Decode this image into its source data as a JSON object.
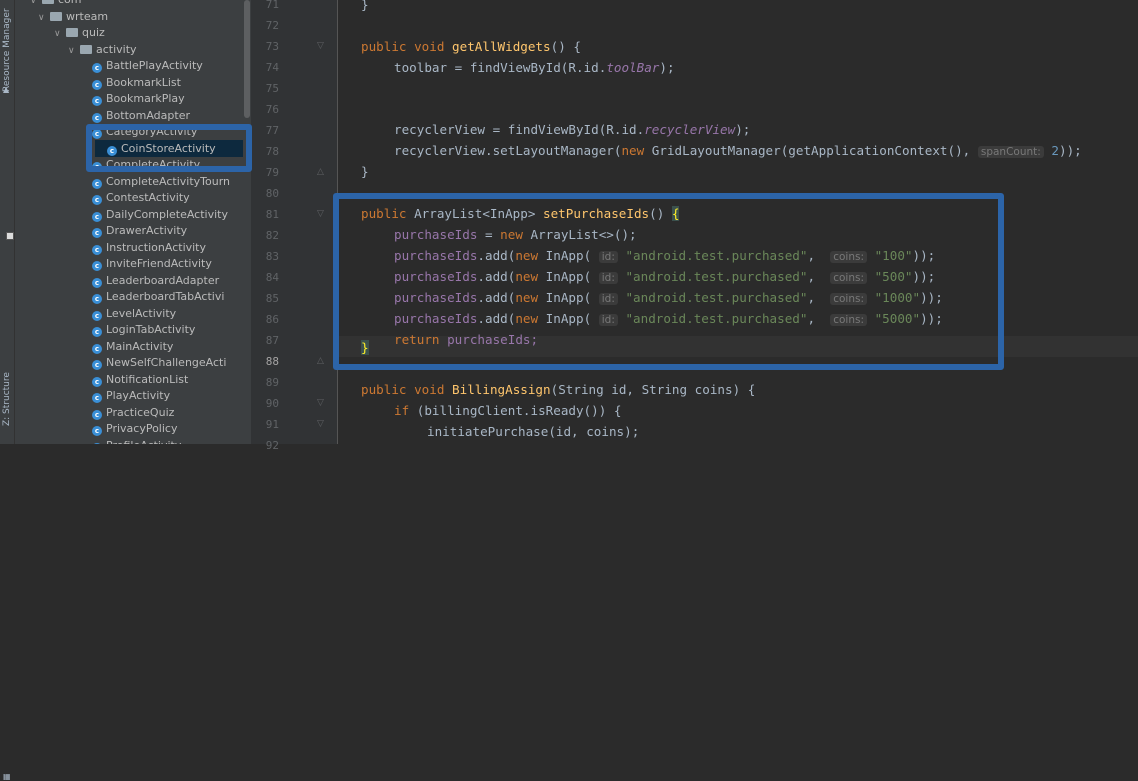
{
  "side_tabs": {
    "resource_manager": "Resource Manager",
    "structure": "Z: Structure"
  },
  "tree": {
    "items": [
      {
        "label": "com",
        "kind": "folder",
        "depth": 0,
        "partial": true
      },
      {
        "label": "wrteam",
        "kind": "folder",
        "depth": 1
      },
      {
        "label": "quiz",
        "kind": "folder",
        "depth": 2
      },
      {
        "label": "activity",
        "kind": "folder",
        "depth": 3
      },
      {
        "label": "BattlePlayActivity",
        "kind": "class",
        "depth": 4
      },
      {
        "label": "BookmarkList",
        "kind": "class",
        "depth": 4
      },
      {
        "label": "BookmarkPlay",
        "kind": "class",
        "depth": 4
      },
      {
        "label": "BottomAdapter",
        "kind": "class",
        "depth": 4
      },
      {
        "label": "CategoryActivity",
        "kind": "class",
        "depth": 4,
        "partial": true
      },
      {
        "label": "CoinStoreActivity",
        "kind": "class",
        "depth": 4,
        "selected": true
      },
      {
        "label": "CompleteActivity",
        "kind": "class",
        "depth": 4,
        "partial": true
      },
      {
        "label": "CompleteActivityTourn",
        "kind": "class",
        "depth": 4
      },
      {
        "label": "ContestActivity",
        "kind": "class",
        "depth": 4
      },
      {
        "label": "DailyCompleteActivity",
        "kind": "class",
        "depth": 4
      },
      {
        "label": "DrawerActivity",
        "kind": "class",
        "depth": 4
      },
      {
        "label": "InstructionActivity",
        "kind": "class",
        "depth": 4
      },
      {
        "label": "InviteFriendActivity",
        "kind": "class",
        "depth": 4
      },
      {
        "label": "LeaderboardAdapter",
        "kind": "class",
        "depth": 4
      },
      {
        "label": "LeaderboardTabActivi",
        "kind": "class",
        "depth": 4
      },
      {
        "label": "LevelActivity",
        "kind": "class",
        "depth": 4
      },
      {
        "label": "LoginTabActivity",
        "kind": "class",
        "depth": 4
      },
      {
        "label": "MainActivity",
        "kind": "class",
        "depth": 4
      },
      {
        "label": "NewSelfChallengeActi",
        "kind": "class",
        "depth": 4
      },
      {
        "label": "NotificationList",
        "kind": "class",
        "depth": 4
      },
      {
        "label": "PlayActivity",
        "kind": "class",
        "depth": 4
      },
      {
        "label": "PracticeQuiz",
        "kind": "class",
        "depth": 4
      },
      {
        "label": "PrivacyPolicy",
        "kind": "class",
        "depth": 4
      },
      {
        "label": "ProfileActivity",
        "kind": "class",
        "depth": 4,
        "partial": true
      }
    ]
  },
  "gutter": {
    "line_numbers": [
      "71",
      "72",
      "73",
      "74",
      "75",
      "76",
      "77",
      "78",
      "79",
      "80",
      "81",
      "82",
      "83",
      "84",
      "85",
      "86",
      "87",
      "88",
      "89",
      "90",
      "91",
      "92"
    ],
    "active_line": "88"
  },
  "code": {
    "l71": "}",
    "l73_kw1": "public",
    "l73_kw2": "void",
    "l73_fn": "getAllWidgets",
    "l73_rest": "() {",
    "l74_a": "toolbar = findViewById(R.id.",
    "l74_b": "toolBar",
    "l74_c": ");",
    "l77_a": "recyclerView = findViewById(R.id.",
    "l77_b": "recyclerView",
    "l77_c": ");",
    "l78_a": "recyclerView.setLayoutManager(",
    "l78_kw": "new",
    "l78_b": " GridLayoutManager(getApplicationContext(), ",
    "l78_hint": "spanCount:",
    "l78_num": "2",
    "l78_c": "));",
    "l79": "}",
    "l81_kw": "public",
    "l81_a": " ArrayList<InApp> ",
    "l81_fn": "setPurchaseIds",
    "l81_b": "() ",
    "l81_brace": "{",
    "l82_a": "purchaseIds",
    "l82_b": " = ",
    "l82_kw": "new",
    "l82_c": " ArrayList<>();",
    "purchases": [
      {
        "call": "purchaseIds",
        "mid": ".add(",
        "kw": "new",
        "ctor": " InApp( ",
        "hint_id": "id:",
        "id": "\"android.test.purchased\"",
        "sep": ",  ",
        "hint_coins": "coins:",
        "coins": "\"100\"",
        "end": "));"
      },
      {
        "call": "purchaseIds",
        "mid": ".add(",
        "kw": "new",
        "ctor": " InApp( ",
        "hint_id": "id:",
        "id": "\"android.test.purchased\"",
        "sep": ",  ",
        "hint_coins": "coins:",
        "coins": "\"500\"",
        "end": "));"
      },
      {
        "call": "purchaseIds",
        "mid": ".add(",
        "kw": "new",
        "ctor": " InApp( ",
        "hint_id": "id:",
        "id": "\"android.test.purchased\"",
        "sep": ",  ",
        "hint_coins": "coins:",
        "coins": "\"1000\"",
        "end": "));"
      },
      {
        "call": "purchaseIds",
        "mid": ".add(",
        "kw": "new",
        "ctor": " InApp( ",
        "hint_id": "id:",
        "id": "\"android.test.purchased\"",
        "sep": ",  ",
        "hint_coins": "coins:",
        "coins": "\"5000\"",
        "end": "));"
      }
    ],
    "l87_kw": "return",
    "l87_a": " purchaseIds;",
    "l88_brace": "}",
    "l90_kw": "public",
    "l90_kw2": "void",
    "l90_fn": "BillingAssign",
    "l90_a": "(String id, String coins) {",
    "l91_kw": "if",
    "l91_a": " (billingClient.isReady()) {",
    "l92_a": "initiatePurchase(id, coins);"
  },
  "colors": {
    "highlight_box": "#2c64a8",
    "keyword": "#cc7832",
    "method": "#ffc66d",
    "field": "#9876aa",
    "string": "#6a8759"
  }
}
